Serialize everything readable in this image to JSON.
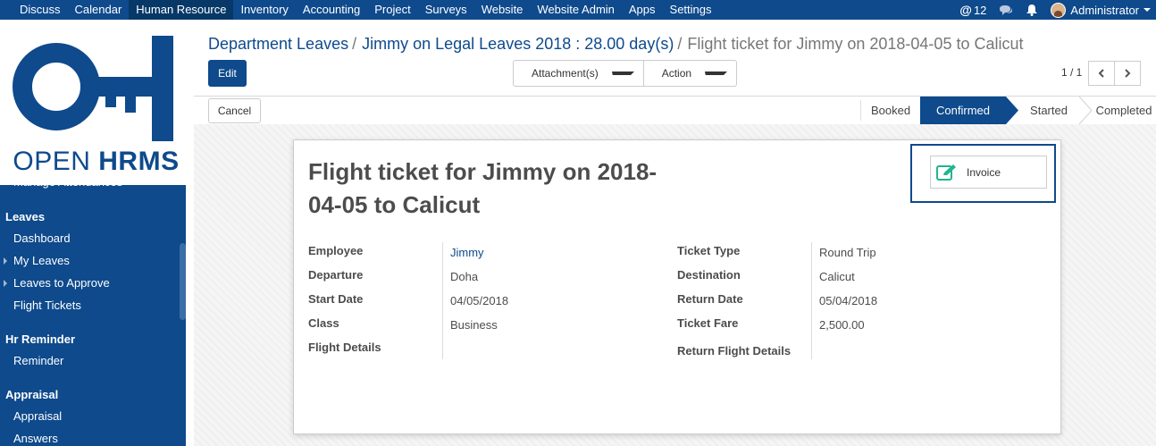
{
  "topnav": {
    "items": [
      "Discuss",
      "Calendar",
      "Human Resource",
      "Inventory",
      "Accounting",
      "Project",
      "Surveys",
      "Website",
      "Website Admin",
      "Apps",
      "Settings"
    ],
    "active_item": "Human Resource",
    "mentions_count": "12",
    "user_name": "Administrator"
  },
  "sidebar": {
    "brand_open": "OPEN",
    "brand_hrms": "HRMS",
    "cut_item": "Manage Attendances",
    "sections": [
      {
        "title": "Leaves",
        "items": [
          "Dashboard",
          "My Leaves",
          "Leaves to Approve",
          "Flight Tickets"
        ]
      },
      {
        "title": "Hr Reminder",
        "items": [
          "Reminder"
        ]
      },
      {
        "title": "Appraisal",
        "items": [
          "Appraisal",
          "Answers"
        ]
      }
    ]
  },
  "breadcrumb": {
    "level1": "Department Leaves",
    "level2": "Jimmy on Legal Leaves 2018 : 28.00 day(s)",
    "current": "Flight ticket for Jimmy on 2018-04-05 to Calicut",
    "separator": "/"
  },
  "controls": {
    "edit": "Edit",
    "attachments": "Attachment(s)",
    "action": "Action",
    "pager": "1 / 1",
    "cancel": "Cancel"
  },
  "status": {
    "stages": [
      "Booked",
      "Confirmed",
      "Started",
      "Completed"
    ],
    "active": "Confirmed"
  },
  "form": {
    "title_line1": "Flight ticket for Jimmy on 2018-",
    "title_line2": "04-05 to Calicut",
    "smart_button": "Invoice",
    "left_fields": [
      {
        "label": "Employee",
        "value": "Jimmy"
      },
      {
        "label": "Departure",
        "value": "Doha"
      },
      {
        "label": "Start Date",
        "value": "04/05/2018"
      },
      {
        "label": "Class",
        "value": "Business"
      },
      {
        "label": "Flight Details",
        "value": ""
      }
    ],
    "right_fields": [
      {
        "label": "Ticket Type",
        "value": "Round Trip"
      },
      {
        "label": "Destination",
        "value": "Calicut"
      },
      {
        "label": "Return Date",
        "value": "05/04/2018"
      },
      {
        "label": "Ticket Fare",
        "value": "2,500.00"
      },
      {
        "label": "Return Flight Details",
        "value": ""
      }
    ]
  },
  "colors": {
    "primary": "#0e4a8c",
    "active_menu": "#073868",
    "smart_icon": "#1fb58f"
  }
}
